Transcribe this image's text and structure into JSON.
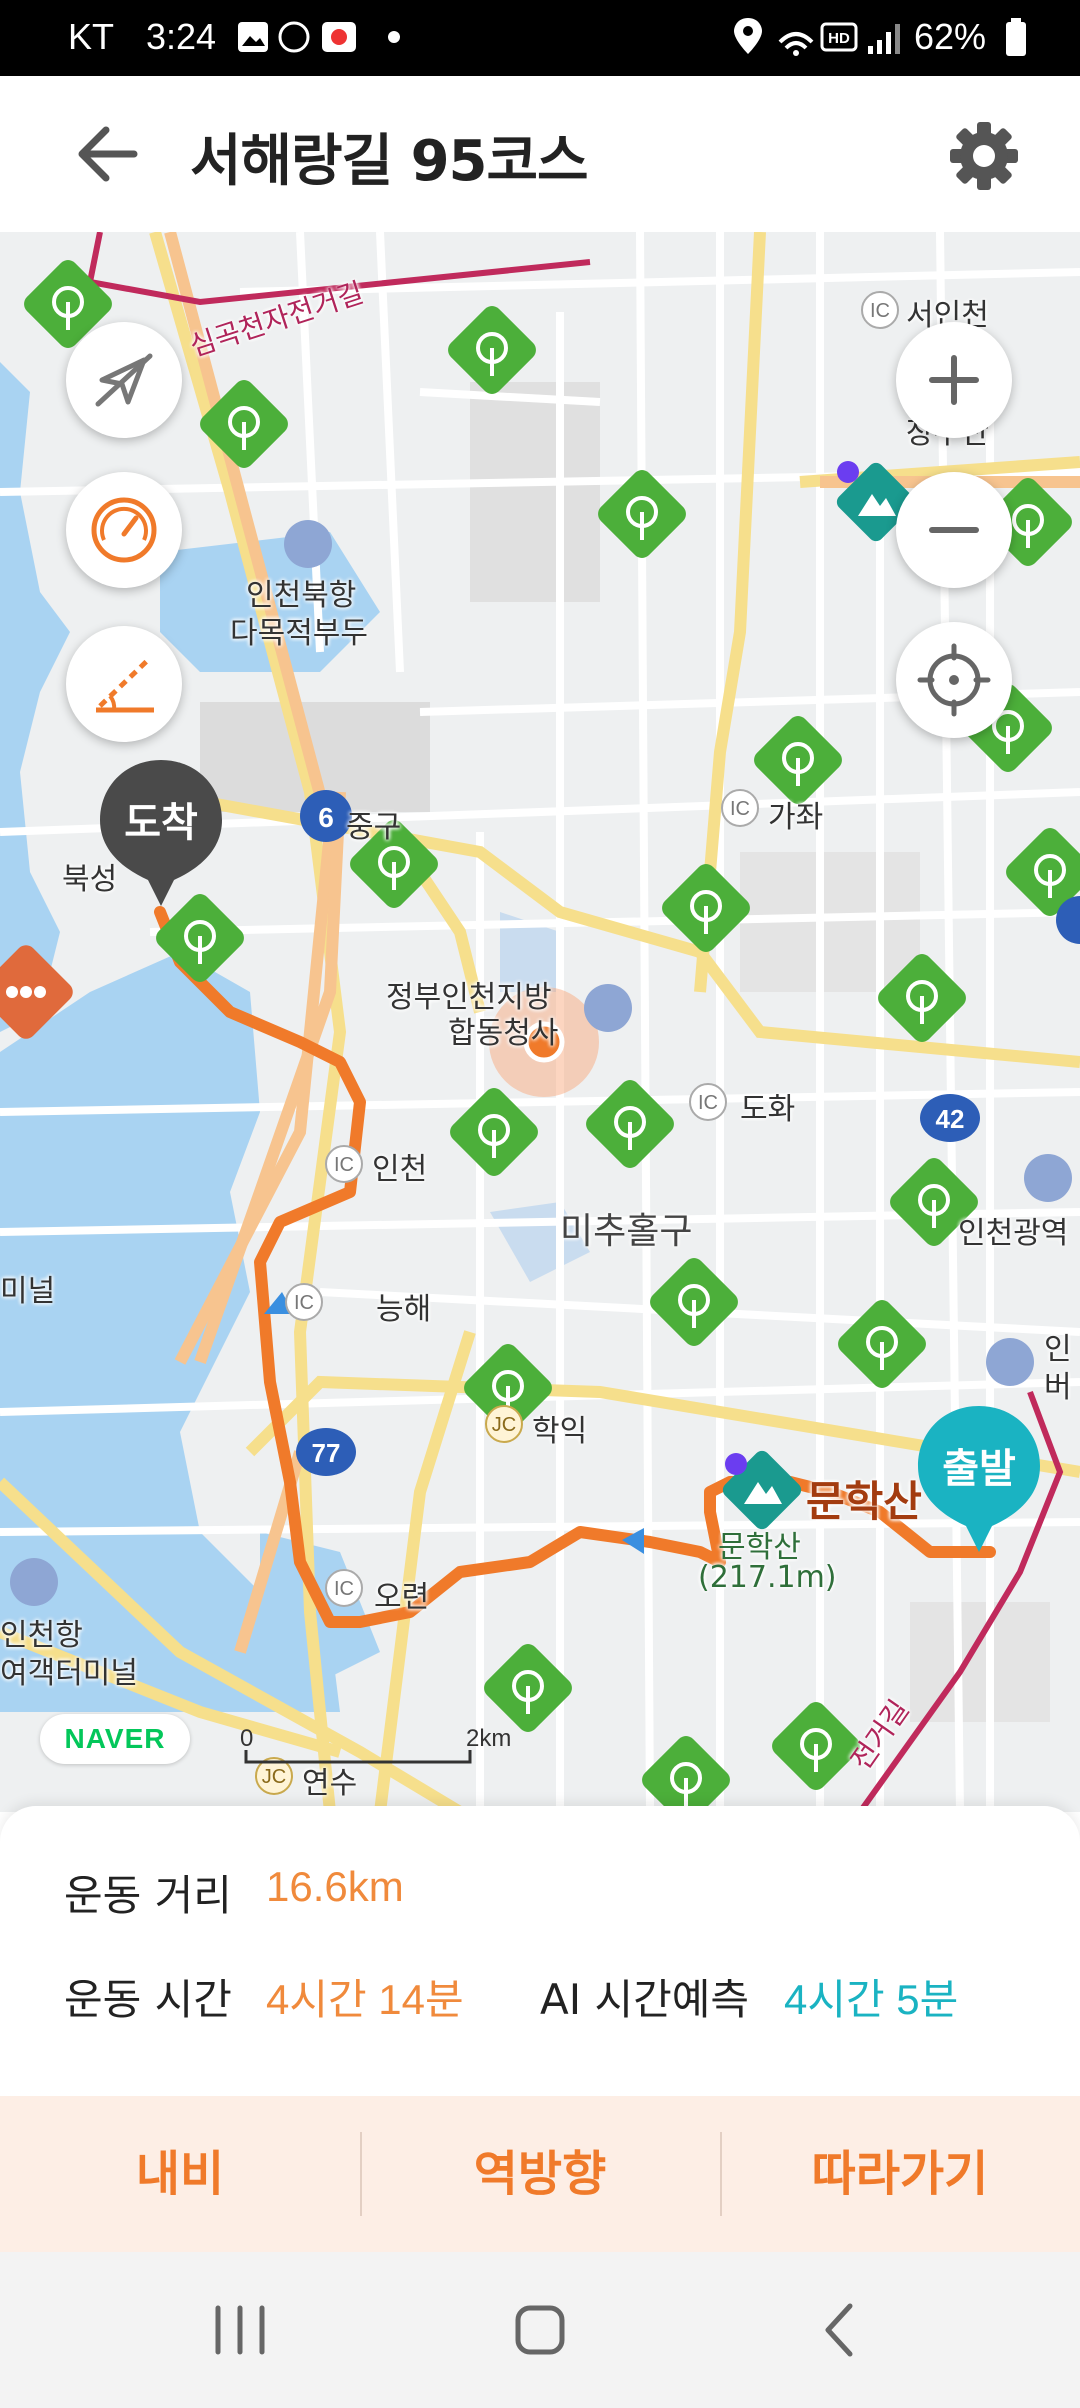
{
  "status_bar": {
    "carrier": "KT",
    "time": "3:24",
    "battery": "62%",
    "network": "HD"
  },
  "header": {
    "title": "서해랑길 95코스",
    "back_icon": "arrow-left-icon",
    "settings_icon": "gear-icon"
  },
  "map": {
    "labels": {
      "bike_path": "심곡천자전거길",
      "seoincheon": "서인천",
      "jangsu_san": "장수산",
      "incheon_north_port": "인천북항",
      "damok_pier": "다목적부두",
      "jung_gu": "중구",
      "gajwa": "가좌",
      "buksung": "북성",
      "gov_complex_1": "정부인천지방",
      "gov_complex_2": "합동청사",
      "dohwa": "도화",
      "incheon_ic": "인천",
      "michuhol": "미추홀구",
      "incheon_metro": "인천광역",
      "terminal_left": "미널",
      "neunghae": "능해",
      "incheon_bus_1": "인",
      "incheon_bus_2": "버",
      "hakik": "학익",
      "munhak_mountain": "문학산",
      "munhak_peak": "문학산",
      "munhak_height": "(217.1m)",
      "oryeon": "오련",
      "incheon_port": "인천항",
      "ferry_terminal": "여객터미널",
      "yeonsu": "연수",
      "bike_path_2": "전거길",
      "route_6": "6",
      "route_42": "42",
      "route_77": "77",
      "ic": "IC",
      "jc": "JC"
    },
    "scale": {
      "start": "0",
      "end": "2km"
    },
    "pins": {
      "arrival": "도착",
      "departure": "출발"
    },
    "logo": "NAVER",
    "controls": {
      "zoom_in_icon": "plus-icon",
      "zoom_out_icon": "minus-icon",
      "locate_icon": "crosshair-icon",
      "compass_off_icon": "navigation-off-icon",
      "speed_icon": "speedometer-icon",
      "slope_icon": "elevation-icon"
    }
  },
  "stats": {
    "distance_label": "운동 거리",
    "distance_value": "16.6km",
    "time_label": "운동 시간",
    "time_value": "4시간 14분",
    "ai_label": "AI 시간예측",
    "ai_value": "4시간 5분"
  },
  "actions": {
    "navigate": "내비",
    "reverse": "역방향",
    "follow": "따라가기"
  },
  "colors": {
    "route": "#f07a2a",
    "teal": "#1ab3c2",
    "action_bg": "#fdeee5"
  }
}
